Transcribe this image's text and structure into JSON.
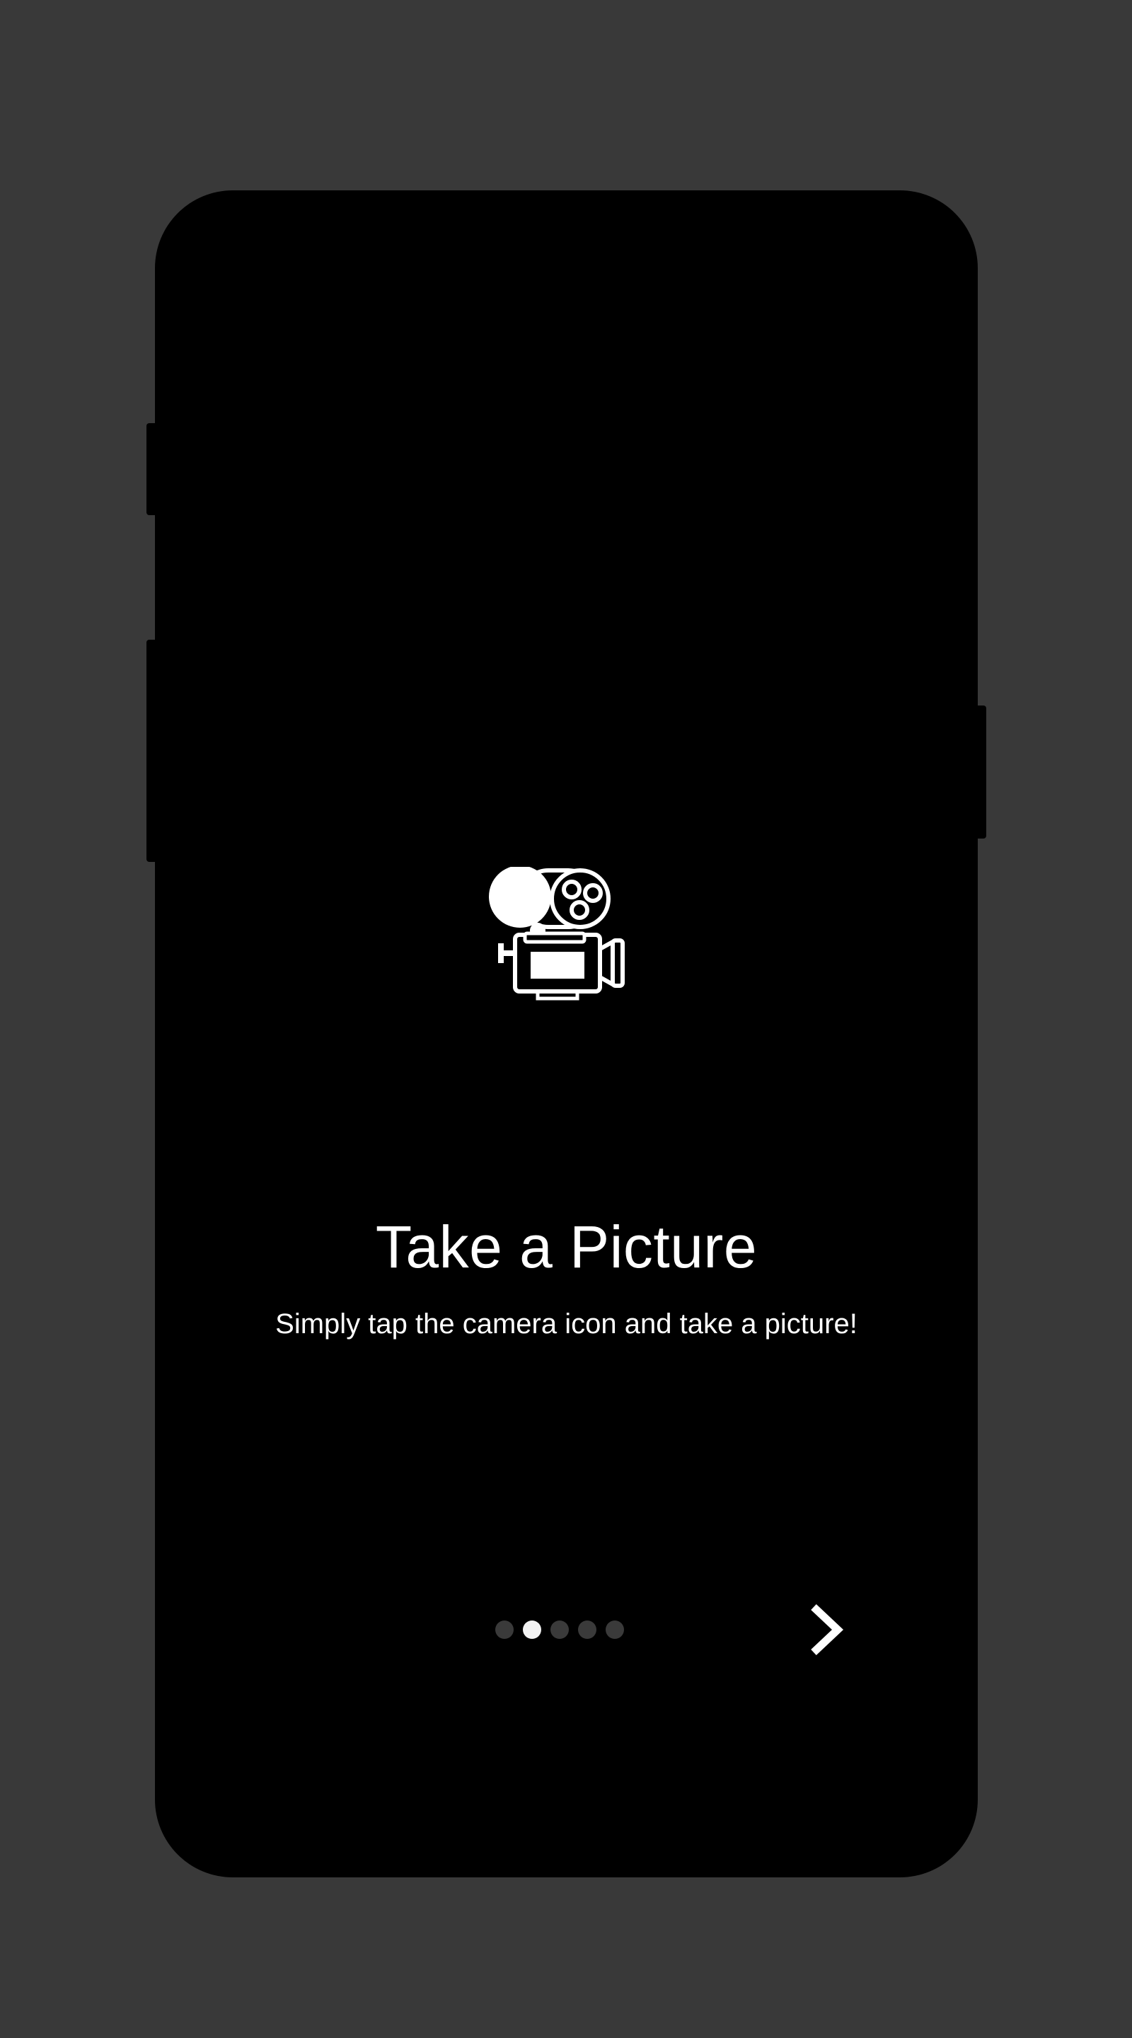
{
  "onboarding": {
    "title": "Take a Picture",
    "subtitle": "Simply tap the camera icon and take a picture!",
    "hero_icon": "movie-camera-icon",
    "pager": {
      "total_pages": 5,
      "current_page": 2
    },
    "next_icon": "chevron-right-icon"
  },
  "colors": {
    "background": "#393939",
    "screen": "#000000",
    "text": "#ffffff",
    "dot_inactive": "#3a3a3a",
    "dot_active": "#f2f2f2"
  }
}
